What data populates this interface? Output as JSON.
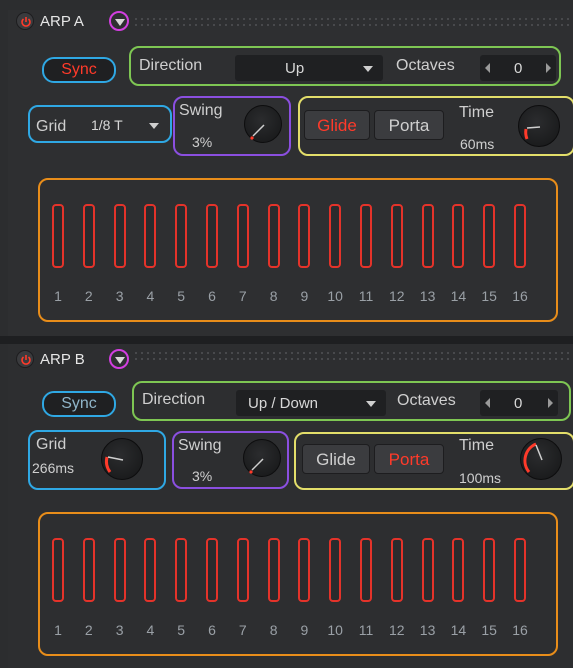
{
  "arp_a": {
    "title": "ARP A",
    "sync_label": "Sync",
    "direction_label": "Direction",
    "direction_value": "Up",
    "octaves_label": "Octaves",
    "octaves_value": "0",
    "grid_label": "Grid",
    "grid_value": "1/8 T",
    "swing_label": "Swing",
    "swing_value": "3%",
    "glide_label": "Glide",
    "porta_label": "Porta",
    "time_label": "Time",
    "time_value": "60ms",
    "steps": [
      "1",
      "2",
      "3",
      "4",
      "5",
      "6",
      "7",
      "8",
      "9",
      "10",
      "11",
      "12",
      "13",
      "14",
      "15",
      "16"
    ]
  },
  "arp_b": {
    "title": "ARP B",
    "sync_label": "Sync",
    "direction_label": "Direction",
    "direction_value": "Up / Down",
    "octaves_label": "Octaves",
    "octaves_value": "0",
    "grid_label": "Grid",
    "grid_value": "266ms",
    "swing_label": "Swing",
    "swing_value": "3%",
    "glide_label": "Glide",
    "porta_label": "Porta",
    "time_label": "Time",
    "time_value": "100ms",
    "steps": [
      "1",
      "2",
      "3",
      "4",
      "5",
      "6",
      "7",
      "8",
      "9",
      "10",
      "11",
      "12",
      "13",
      "14",
      "15",
      "16"
    ]
  },
  "colors": {
    "active_red": "#ff3a2a",
    "sync_blue": "#2fa8e4",
    "direction_green": "#7ec653",
    "swing_purple": "#8b4fe0",
    "glide_yellow": "#e3de6a",
    "steps_orange": "#e88d1a",
    "menu_magenta": "#d23ee0"
  }
}
